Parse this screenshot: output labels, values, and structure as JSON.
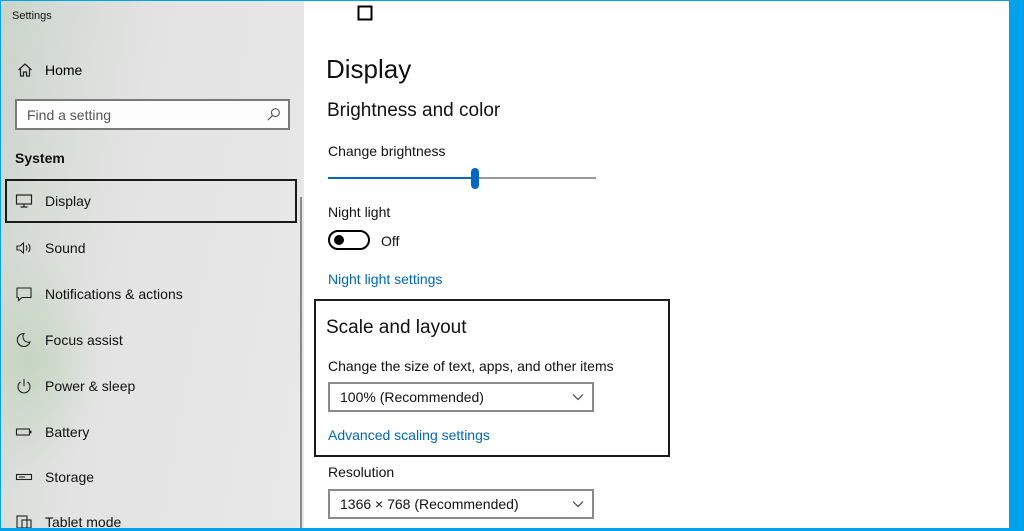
{
  "window": {
    "title": "Settings"
  },
  "sidebar": {
    "home_label": "Home",
    "search": {
      "placeholder": "Find a setting",
      "value": ""
    },
    "section_label": "System",
    "items": [
      {
        "label": "Display",
        "icon": "monitor-icon",
        "active": true
      },
      {
        "label": "Sound",
        "icon": "speaker-icon",
        "active": false
      },
      {
        "label": "Notifications & actions",
        "icon": "notification-icon",
        "active": false
      },
      {
        "label": "Focus assist",
        "icon": "moon-icon",
        "active": false
      },
      {
        "label": "Power & sleep",
        "icon": "power-icon",
        "active": false
      },
      {
        "label": "Battery",
        "icon": "battery-icon",
        "active": false
      },
      {
        "label": "Storage",
        "icon": "storage-icon",
        "active": false
      },
      {
        "label": "Tablet mode",
        "icon": "tablet-mode-icon",
        "active": false
      }
    ]
  },
  "main": {
    "title": "Display",
    "brightness_section": {
      "header": "Brightness and color",
      "brightness_label": "Change brightness",
      "brightness_level": 0.55,
      "night_light_label": "Night light",
      "night_light_state": "Off",
      "night_light_link": "Night light settings"
    },
    "scale_section": {
      "header": "Scale and layout",
      "size_label": "Change the size of text, apps, and other items",
      "size_value": "100% (Recommended)",
      "advanced_link": "Advanced scaling settings",
      "resolution_label": "Resolution",
      "resolution_value": "1366 × 768 (Recommended)"
    }
  },
  "colors": {
    "accent": "#0067c0",
    "link": "#0067b8",
    "window_border": "#00a2ed",
    "sidebar_bg": "#e6e6e6"
  }
}
